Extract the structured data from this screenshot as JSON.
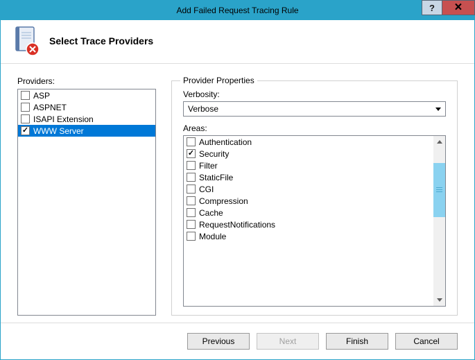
{
  "window": {
    "title": "Add Failed Request Tracing Rule"
  },
  "header": {
    "title": "Select Trace Providers"
  },
  "providers": {
    "label": "Providers:",
    "items": [
      {
        "label": "ASP",
        "checked": false,
        "selected": false
      },
      {
        "label": "ASPNET",
        "checked": false,
        "selected": false
      },
      {
        "label": "ISAPI Extension",
        "checked": false,
        "selected": false
      },
      {
        "label": "WWW Server",
        "checked": true,
        "selected": true
      }
    ]
  },
  "properties": {
    "legend": "Provider Properties",
    "verbosity_label": "Verbosity:",
    "verbosity_value": "Verbose",
    "areas_label": "Areas:",
    "areas": [
      {
        "label": "Authentication",
        "checked": false
      },
      {
        "label": "Security",
        "checked": true
      },
      {
        "label": "Filter",
        "checked": false
      },
      {
        "label": "StaticFile",
        "checked": false
      },
      {
        "label": "CGI",
        "checked": false
      },
      {
        "label": "Compression",
        "checked": false
      },
      {
        "label": "Cache",
        "checked": false
      },
      {
        "label": "RequestNotifications",
        "checked": false
      },
      {
        "label": "Module",
        "checked": false
      }
    ]
  },
  "footer": {
    "previous": "Previous",
    "next": "Next",
    "finish": "Finish",
    "cancel": "Cancel"
  }
}
